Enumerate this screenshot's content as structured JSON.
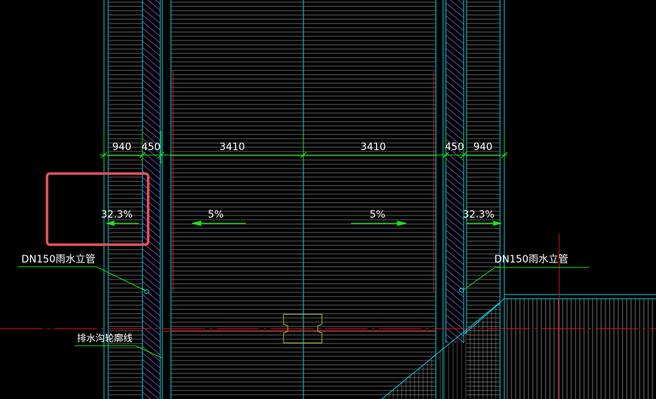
{
  "dimensions": [
    "940",
    "450",
    "3410",
    "3410",
    "450",
    "940"
  ],
  "slopes": [
    "32.3%",
    "5%",
    "5%",
    "32.3%"
  ],
  "labels": {
    "pipe_left": "DN150雨水立管",
    "pipe_right": "DN150雨水立管",
    "drain_outline": "排水沟轮廓线"
  },
  "colors": {
    "background": "#000000",
    "hatch": "#ffffff",
    "cyan": "#00d8e8",
    "red": "#e0141e",
    "green": "#19e619",
    "wall_hatch": "#8a5cd6",
    "yellow": "#b5b52a",
    "selection": "#e8525f"
  }
}
